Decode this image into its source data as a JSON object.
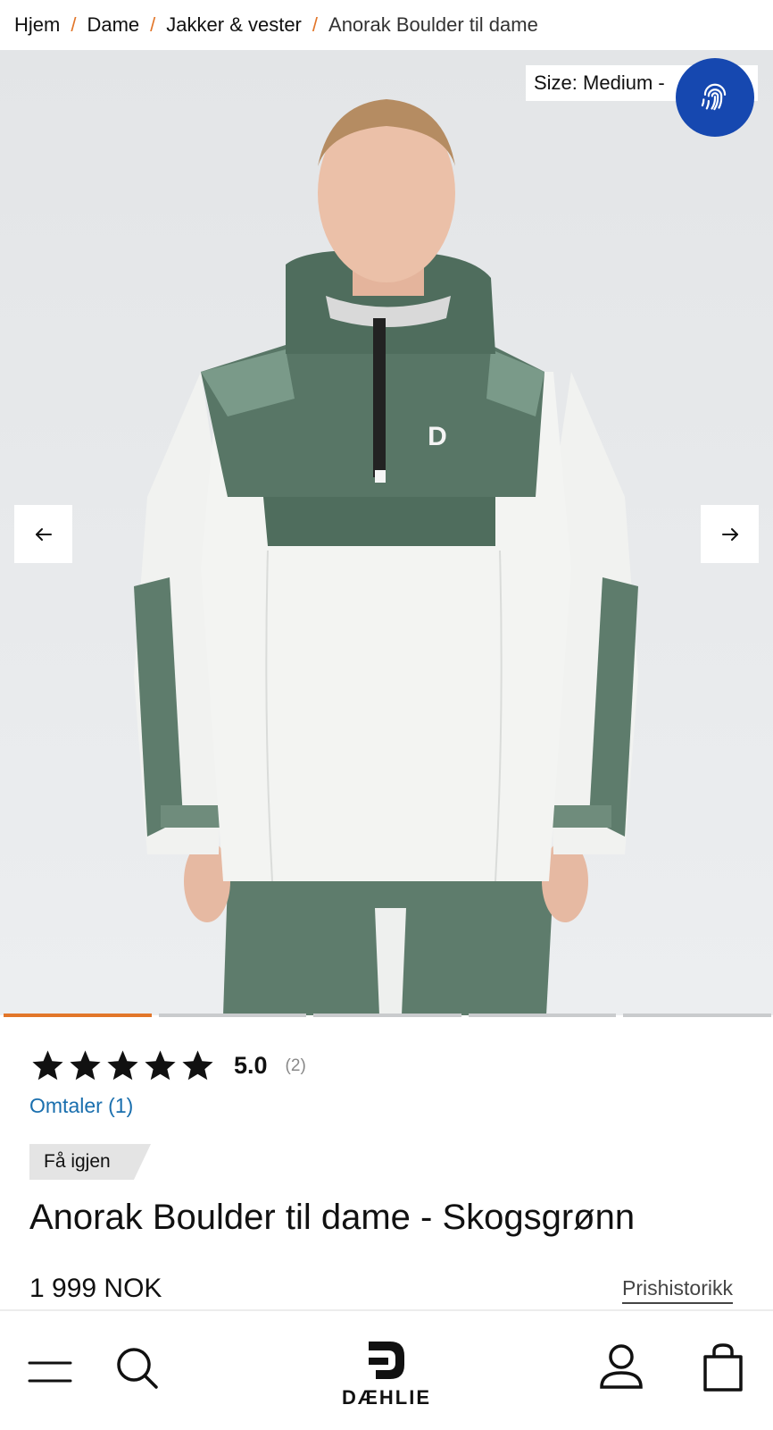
{
  "breadcrumb": {
    "items": [
      "Hjem",
      "Dame",
      "Jakker & vester"
    ],
    "current": "Anorak Boulder til dame",
    "separator": "/"
  },
  "gallery": {
    "size_label": "Size: Medium -",
    "fingerprint_icon": "fingerprint-icon",
    "prev_icon": "arrow-left-icon",
    "next_icon": "arrow-right-icon",
    "slide_count": 5,
    "active_slide": 1
  },
  "product": {
    "rating_stars": 5,
    "rating_value": "5.0",
    "rating_count": "(2)",
    "reviews_link": "Omtaler (1)",
    "badge": "Få igjen",
    "title": "Anorak Boulder til dame - Skogsgrønn",
    "price": "1 999 NOK",
    "price_history": "Prishistorikk"
  },
  "bottom_nav": {
    "menu_icon": "hamburger-menu-icon",
    "search_icon": "search-icon",
    "logo_text": "DÆHLIE",
    "account_icon": "user-icon",
    "cart_icon": "shopping-bag-icon"
  },
  "colors": {
    "accent": "#e2762a",
    "link": "#1a6fae",
    "fingerprint_bg": "#1648b0",
    "jacket_green": "#5b7a6a",
    "jacket_white": "#f0f1ef"
  }
}
